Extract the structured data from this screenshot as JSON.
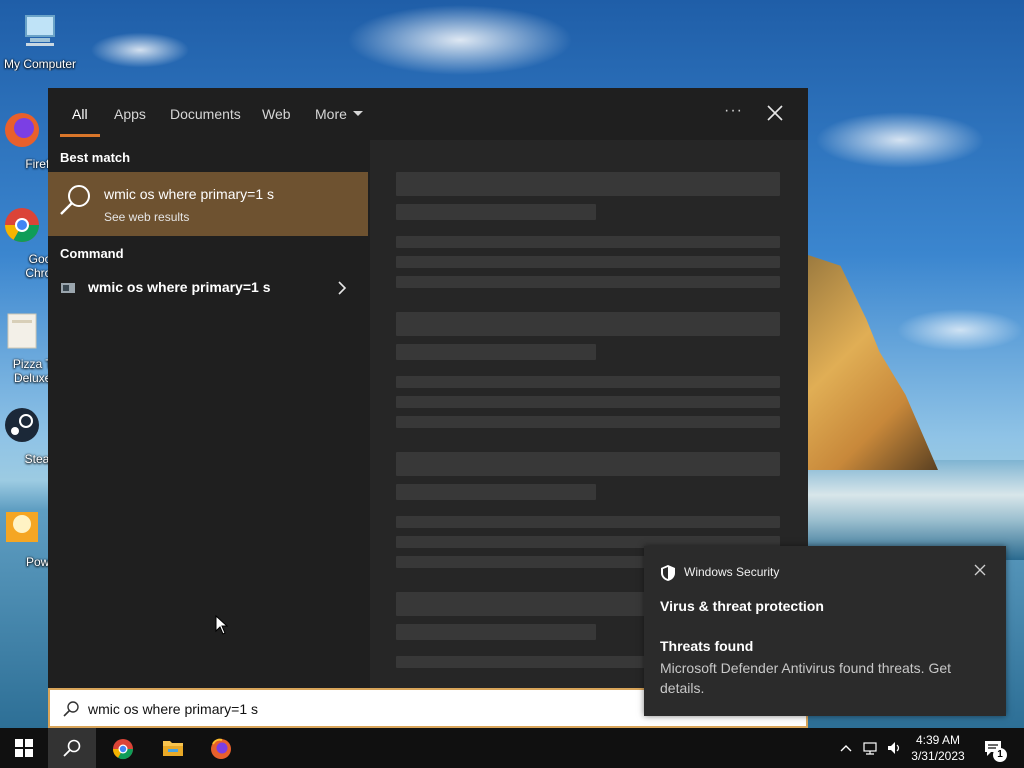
{
  "desktop": {
    "icons": [
      {
        "label": "My Computer",
        "icon": "computer-icon"
      },
      {
        "label": "Firefo",
        "icon": "firefox-icon"
      },
      {
        "label": "Goog\nChron",
        "icon": "chrome-icon"
      },
      {
        "label": "Pizza To\nDeluxe I",
        "icon": "folder-icon"
      },
      {
        "label": "Stean",
        "icon": "steam-icon"
      },
      {
        "label": "Powd",
        "icon": "game-icon"
      }
    ]
  },
  "search_panel": {
    "tabs": [
      {
        "label": "All",
        "active": true
      },
      {
        "label": "Apps",
        "active": false
      },
      {
        "label": "Documents",
        "active": false
      },
      {
        "label": "Web",
        "active": false
      },
      {
        "label": "More",
        "active": false
      }
    ],
    "ellipsis": "···",
    "best_match_heading": "Best match",
    "best_match": {
      "title": "wmic os where primary=1 s",
      "subtitle": "See web results"
    },
    "command_heading": "Command",
    "command": {
      "title": "wmic os where primary=1 s"
    }
  },
  "search_box": {
    "value": "wmic os where primary=1 s"
  },
  "toast": {
    "app_name": "Windows Security",
    "heading": "Virus & threat protection",
    "subheading": "Threats found",
    "body": "Microsoft Defender Antivirus found threats. Get details."
  },
  "taskbar": {
    "pinned": [
      "start-button",
      "search-button",
      "chrome",
      "file-explorer",
      "firefox"
    ],
    "time": "4:39 AM",
    "date": "3/31/2023",
    "notification_count": "1"
  },
  "colors": {
    "accent": "#d9762a",
    "best_match_bg": "#6e5230",
    "panel_bg": "#1f1f1f"
  }
}
